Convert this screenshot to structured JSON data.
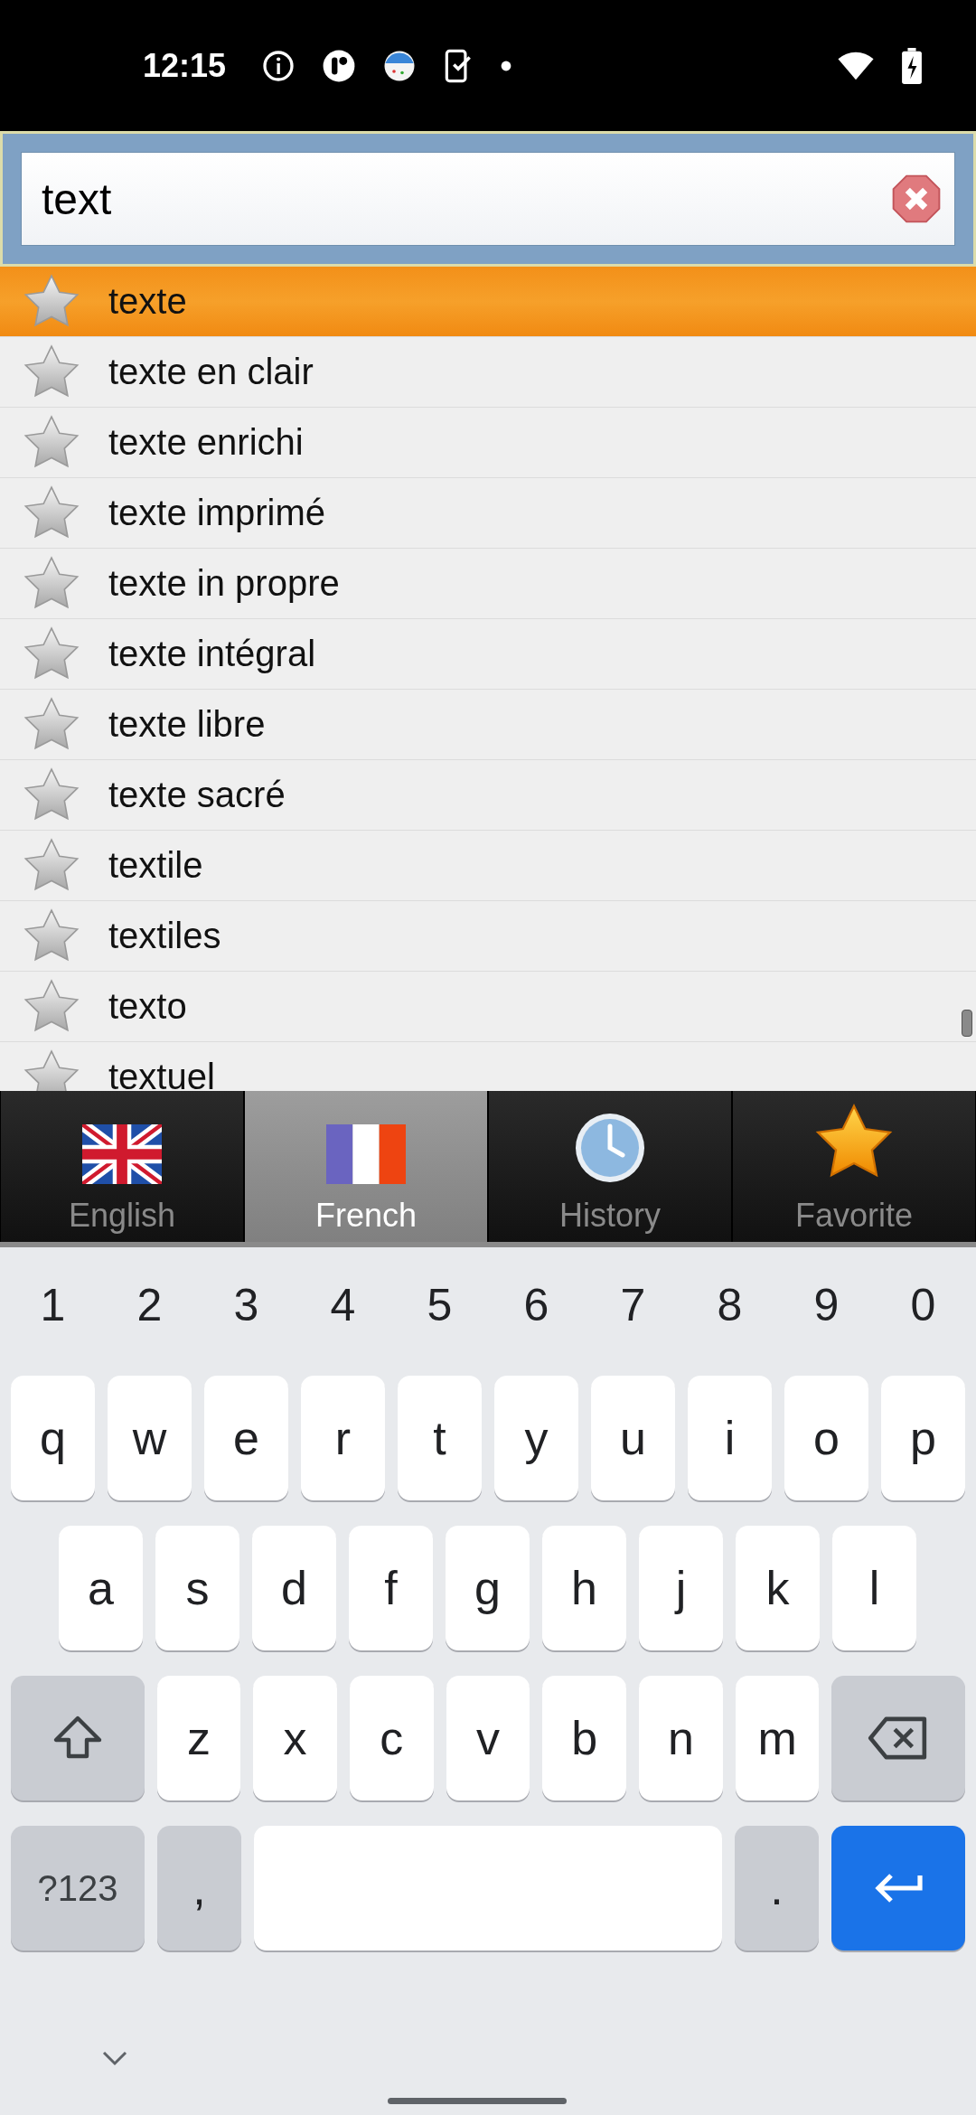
{
  "status_bar": {
    "time": "12:15"
  },
  "search": {
    "value": "text"
  },
  "results": [
    {
      "text": "texte",
      "selected": true,
      "favorite": false
    },
    {
      "text": "texte en clair",
      "selected": false,
      "favorite": false
    },
    {
      "text": "texte enrichi",
      "selected": false,
      "favorite": false
    },
    {
      "text": "texte imprimé",
      "selected": false,
      "favorite": false
    },
    {
      "text": "texte in propre",
      "selected": false,
      "favorite": false
    },
    {
      "text": "texte intégral",
      "selected": false,
      "favorite": false
    },
    {
      "text": "texte libre",
      "selected": false,
      "favorite": false
    },
    {
      "text": "texte sacré",
      "selected": false,
      "favorite": false
    },
    {
      "text": "textile",
      "selected": false,
      "favorite": false
    },
    {
      "text": "textiles",
      "selected": false,
      "favorite": false
    },
    {
      "text": "texto",
      "selected": false,
      "favorite": false
    },
    {
      "text": "textuel",
      "selected": false,
      "favorite": false
    }
  ],
  "tabs": [
    {
      "label": "English",
      "kind": "uk",
      "selected": false
    },
    {
      "label": "French",
      "kind": "fr",
      "selected": true
    },
    {
      "label": "History",
      "kind": "clock",
      "selected": false
    },
    {
      "label": "Favorite",
      "kind": "star",
      "selected": false
    }
  ],
  "keyboard": {
    "number_row": [
      "1",
      "2",
      "3",
      "4",
      "5",
      "6",
      "7",
      "8",
      "9",
      "0"
    ],
    "letter_rows": [
      [
        {
          "kind": "char",
          "label": "q"
        },
        {
          "kind": "char",
          "label": "w"
        },
        {
          "kind": "char",
          "label": "e"
        },
        {
          "kind": "char",
          "label": "r"
        },
        {
          "kind": "char",
          "label": "t"
        },
        {
          "kind": "char",
          "label": "y"
        },
        {
          "kind": "char",
          "label": "u"
        },
        {
          "kind": "char",
          "label": "i"
        },
        {
          "kind": "char",
          "label": "o"
        },
        {
          "kind": "char",
          "label": "p"
        }
      ],
      [
        {
          "kind": "char",
          "label": "a"
        },
        {
          "kind": "char",
          "label": "s"
        },
        {
          "kind": "char",
          "label": "d"
        },
        {
          "kind": "char",
          "label": "f"
        },
        {
          "kind": "char",
          "label": "g"
        },
        {
          "kind": "char",
          "label": "h"
        },
        {
          "kind": "char",
          "label": "j"
        },
        {
          "kind": "char",
          "label": "k"
        },
        {
          "kind": "char",
          "label": "l"
        }
      ],
      [
        {
          "kind": "shift"
        },
        {
          "kind": "char",
          "label": "z"
        },
        {
          "kind": "char",
          "label": "x"
        },
        {
          "kind": "char",
          "label": "c"
        },
        {
          "kind": "char",
          "label": "v"
        },
        {
          "kind": "char",
          "label": "b"
        },
        {
          "kind": "char",
          "label": "n"
        },
        {
          "kind": "char",
          "label": "m"
        },
        {
          "kind": "backspace"
        }
      ]
    ],
    "bottom_row": [
      {
        "kind": "symbols",
        "label": "?123"
      },
      {
        "kind": "punct",
        "label": ","
      },
      {
        "kind": "space"
      },
      {
        "kind": "punct",
        "label": "."
      },
      {
        "kind": "enter"
      }
    ]
  }
}
